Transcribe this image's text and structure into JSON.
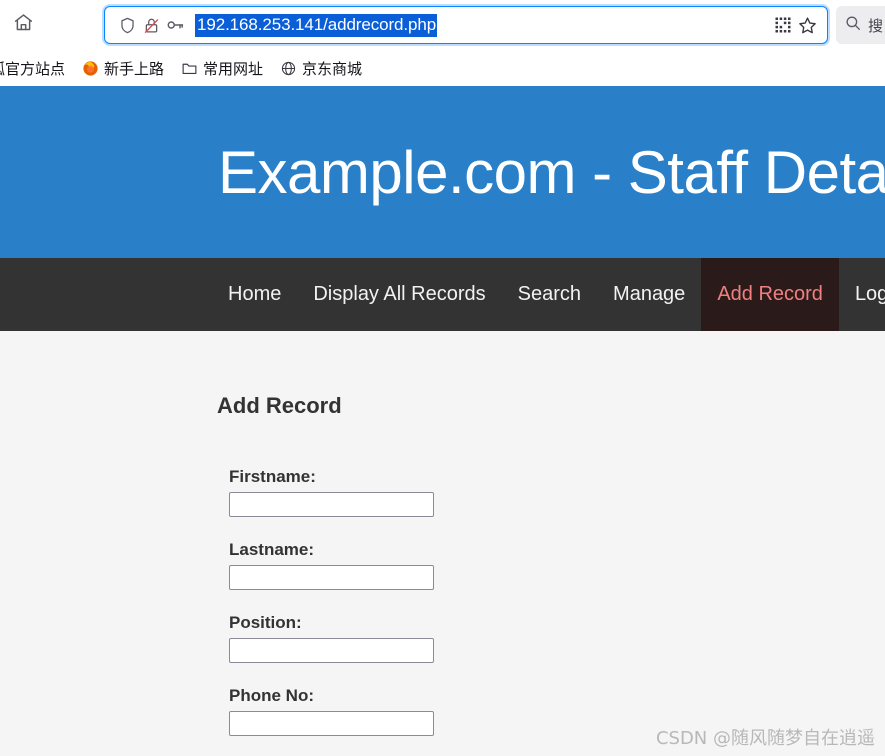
{
  "browser": {
    "home_icon": "home-icon",
    "urlbar": {
      "shield_icon": "shield-icon",
      "insecure_icon": "no-lock-crossed-icon",
      "key_icon": "key-icon",
      "url": "192.168.253.141/addrecord.php",
      "qr_icon": "qr-code-icon",
      "bookmark_icon": "star-icon"
    },
    "search": {
      "icon": "search-icon",
      "label": "搜"
    },
    "bookmarks": [
      {
        "icon": "none",
        "label": "狐官方站点"
      },
      {
        "icon": "firefox-icon",
        "label": "新手上路"
      },
      {
        "icon": "folder-icon",
        "label": "常用网址"
      },
      {
        "icon": "globe-icon",
        "label": "京东商城"
      }
    ]
  },
  "site": {
    "title": "Example.com - Staff Deta",
    "nav": [
      {
        "label": "Home",
        "active": false
      },
      {
        "label": "Display All Records",
        "active": false
      },
      {
        "label": "Search",
        "active": false
      },
      {
        "label": "Manage",
        "active": false
      },
      {
        "label": "Add Record",
        "active": true
      },
      {
        "label": "Log Ou",
        "active": false
      }
    ],
    "colors": {
      "header_blue": "#2980c8",
      "nav_dark": "#333333",
      "active_bg": "#2b1a1a",
      "active_text": "#f08080",
      "page_bg": "#f5f5f5"
    }
  },
  "form": {
    "heading": "Add Record",
    "fields": [
      {
        "label": "Firstname:",
        "value": "",
        "placeholder": ""
      },
      {
        "label": "Lastname:",
        "value": "",
        "placeholder": ""
      },
      {
        "label": "Position:",
        "value": "",
        "placeholder": ""
      },
      {
        "label": "Phone No:",
        "value": "",
        "placeholder": ""
      }
    ]
  },
  "watermark": "CSDN @随风随梦自在逍遥"
}
